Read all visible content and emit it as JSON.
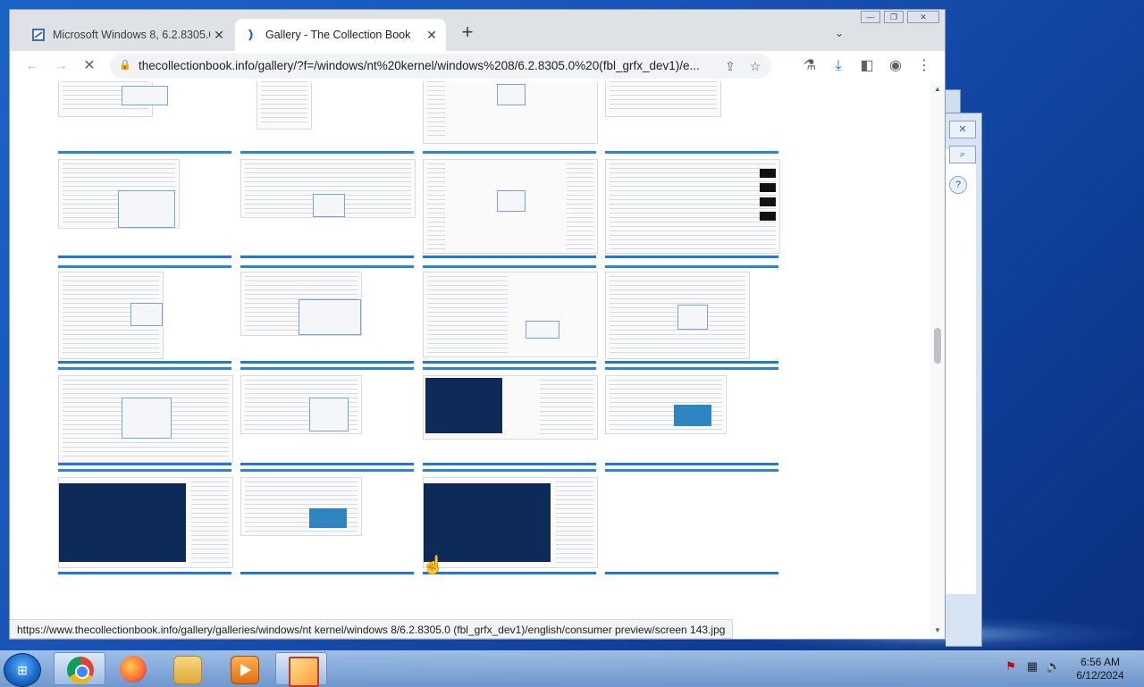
{
  "browser": {
    "tabs": [
      {
        "title": "Microsoft Windows 8, 6.2.8305.0",
        "active": false,
        "favicon": "windows-logo-icon"
      },
      {
        "title": "Gallery - The Collection Book",
        "active": true,
        "favicon": "collection-book-icon"
      }
    ],
    "new_tab_label": "+",
    "url": "thecollectionbook.info/gallery/?f=/windows/nt%20kernel/windows%208/6.2.8305.0%20(fbl_grfx_dev1)/e...",
    "status_url": "https://www.thecollectionbook.info/gallery/galleries/windows/nt kernel/windows 8/6.2.8305.0 (fbl_grfx_dev1)/english/consumer preview/screen 143.jpg",
    "loading": true
  },
  "gallery": {
    "columns": 4,
    "rows": 6,
    "empty_last_cell": true
  },
  "taskbar": {
    "apps": [
      "chrome",
      "firefox",
      "file-explorer",
      "media-player",
      "image-viewer"
    ],
    "active_app": "chrome",
    "clock_time": "6:56 AM",
    "clock_date": "6/12/2024"
  },
  "colors": {
    "accent": "#1f78d1",
    "desktop": "#1a55b8",
    "tab_bg": "#dee1e6"
  }
}
